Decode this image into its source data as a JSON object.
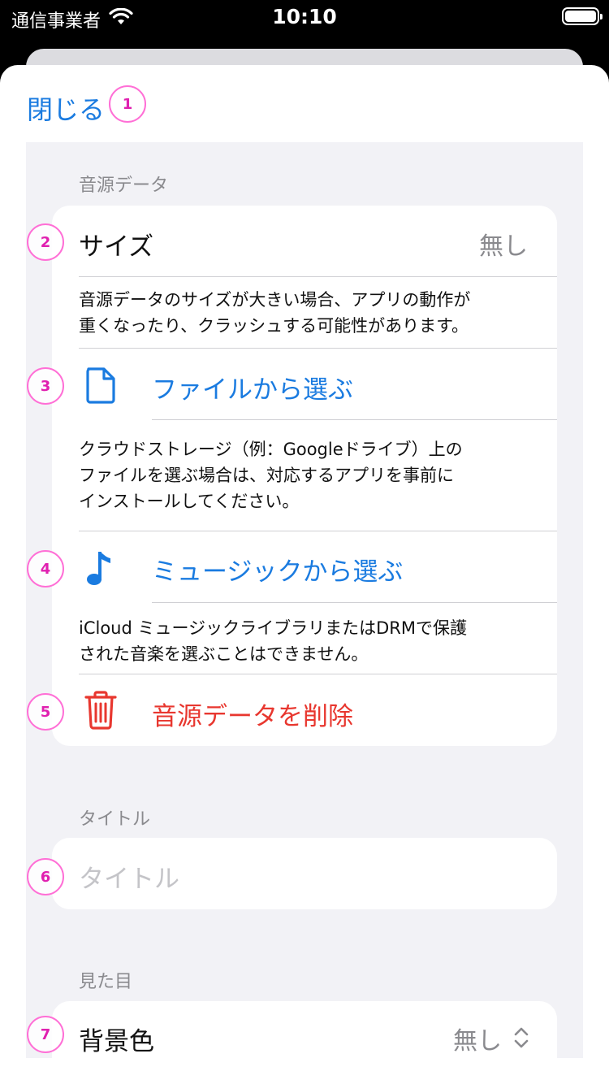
{
  "status_bar": {
    "carrier": "通信事業者",
    "time": "10:10"
  },
  "header": {
    "close_label": "閉じる"
  },
  "markers": [
    "1",
    "2",
    "3",
    "4",
    "5",
    "6",
    "7"
  ],
  "audio_section": {
    "header": "音源データ",
    "size_label": "サイズ",
    "size_value": "無し",
    "size_desc_line1": "音源データのサイズが大きい場合、アプリの動作が",
    "size_desc_line2": "重くなったり、クラッシュする可能性があります。",
    "file_action": "ファイルから選ぶ",
    "file_desc_line1": "クラウドストレージ（例：Googleドライブ）上の",
    "file_desc_line2": "ファイルを選ぶ場合は、対応するアプリを事前に",
    "file_desc_line3": "インストールしてください。",
    "music_action": "ミュージックから選ぶ",
    "music_desc_line1": "iCloud ミュージックライブラリまたはDRMで保護",
    "music_desc_line2": "された音楽を選ぶことはできません。",
    "delete_action": "音源データを削除"
  },
  "title_section": {
    "header": "タイトル",
    "placeholder": "タイトル"
  },
  "appearance_section": {
    "header": "見た目",
    "bg_color_label": "背景色",
    "bg_color_value": "無し"
  },
  "colors": {
    "accent": "#1a7be0",
    "destructive": "#e8372f",
    "marker": "#ff6fd6"
  },
  "icons": {
    "wifi": "wifi-icon",
    "battery": "battery-icon",
    "file": "document-icon",
    "music": "music-note-icon",
    "trash": "trash-icon",
    "chevron": "chevron-up-down-icon"
  }
}
